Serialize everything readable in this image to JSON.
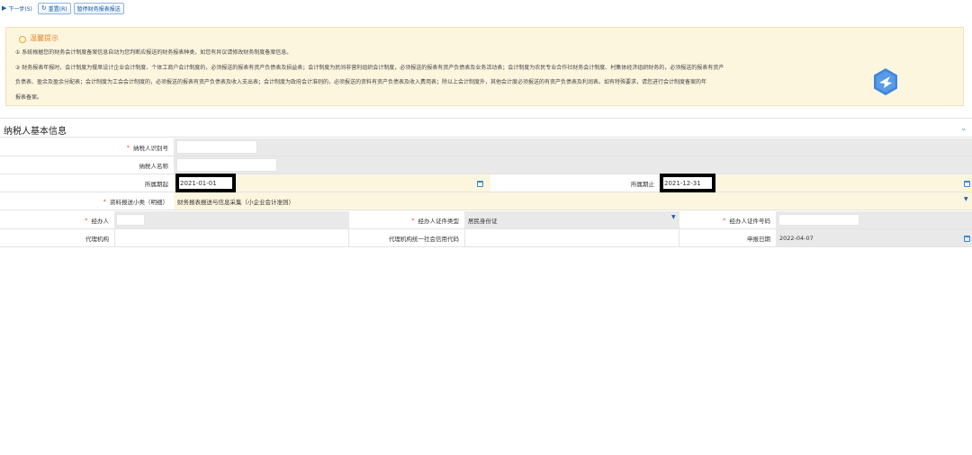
{
  "toolbar": {
    "next_label": "下一步(S)",
    "reset_label": "重置(R)",
    "suspend_label": "暂停财务报表报送"
  },
  "notice": {
    "title": "温馨提示",
    "line1": "① 系统根据您的财务会计制度备案信息自动为您判断应报送的财务报表种类，如您有异议请修改财务制度备案信息。",
    "line2": "② 财务报表年报时，会计制度为餐席设计企业会计制度、个体工商户会计制度的，必须报送的报表有资产负债表及损益表；会计制度为民间非营利组织会计制度，必须报送的报表有资产负债表及业务活动表；会计制度为农民专业合作社财务会计制度、村集体经济组织财务的，必须报送的报表有资产",
    "line3": "负债表、盈余及盈余分配表；会计制度为工会会计制度的，必须报送的报表有资产负债表及收入支出表；会计制度为政府会计准则的，必须报送的资料有资产负债表及收入费用表；除以上会计制度外，其他会计度必须报送的有资产负债表及利润表。如有特殊要求，请您进行会计制度备案的年",
    "line4": "报表备案。"
  },
  "section": {
    "title": "纳税人基本信息"
  },
  "form": {
    "taxpayer_id_label": "纳税人识别号",
    "taxpayer_name_label": "纳税人名称",
    "period_start_label": "所属期起",
    "period_start_value": "2021-01-01",
    "period_end_label": "所属期止",
    "period_end_value": "2021-12-31",
    "report_type_label": "资料报送小类（明细）",
    "report_type_value": "财务报表报送与信息采集（小企业会计准则）",
    "handler_label": "经办人",
    "handler_id_type_label": "经办人证件类型",
    "handler_id_type_value": "居民身份证",
    "handler_id_number_label": "经办人证件号码",
    "agency_label": "代理机构",
    "agency_credit_code_label": "代理机构统一社会信用代码",
    "declare_date_label": "申报日期",
    "declare_date_value": "2022-04-07"
  },
  "colors": {
    "accent": "#1a5aa6",
    "required": "#e8552a",
    "notice_bg": "#fdf6df",
    "field_gray": "#e9e9e9"
  }
}
